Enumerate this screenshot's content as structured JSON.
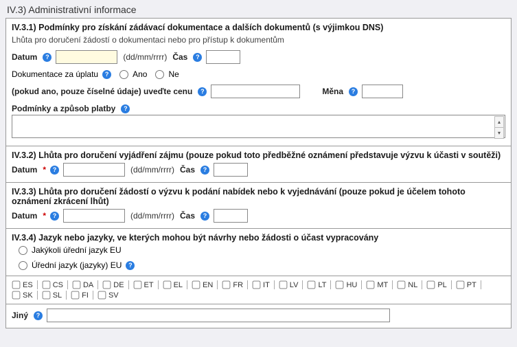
{
  "mainTitle": "IV.3) Administrativní informace",
  "s1": {
    "title": "IV.3.1) Podmínky pro získání zádávací dokumentace a dalších dokumentů (s výjimkou DNS)",
    "sub": "Lhůta pro doručení žádostí o dokumentaci nebo pro přístup k dokumentům",
    "datumLbl": "Datum",
    "dateFmt": "(dd/mm/rrrr)",
    "casLbl": "Čas",
    "docFeeLbl": "Dokumentace za úplatu",
    "ano": "Ano",
    "ne": "Ne",
    "priceLbl": "(pokud ano, pouze číselné údaje) uveďte cenu",
    "menaLbl": "Měna",
    "payCondLbl": "Podmínky a způsob platby"
  },
  "s2": {
    "title": "IV.3.2) Lhůta pro doručení vyjádření zájmu (pouze pokud toto předběžné oznámení představuje výzvu k účasti v soutěži)",
    "datumLbl": "Datum",
    "dateFmt": "(dd/mm/rrrr)",
    "casLbl": "Čas"
  },
  "s3": {
    "title": "IV.3.3) Lhůta pro doručení žádostí o výzvu k podání nabídek nebo k vyjednávání (pouze pokud je účelem tohoto oznámení zkrácení lhůt)",
    "datumLbl": "Datum",
    "dateFmt": "(dd/mm/rrrr)",
    "casLbl": "Čas"
  },
  "s4": {
    "title": "IV.3.4) Jazyk nebo jazyky, ve kterých mohou být návrhy nebo žádosti o účast vypracovány",
    "optAny": "Jakýkoli úřední jazyk EU",
    "optOfficial": "Úřední jazyk (jazyky) EU"
  },
  "langs": [
    "ES",
    "CS",
    "DA",
    "DE",
    "ET",
    "EL",
    "EN",
    "FR",
    "IT",
    "LV",
    "LT",
    "HU",
    "MT",
    "NL",
    "PL",
    "PT",
    "SK",
    "SL",
    "FI",
    "SV"
  ],
  "jinyLbl": "Jiný",
  "reqMark": "*"
}
